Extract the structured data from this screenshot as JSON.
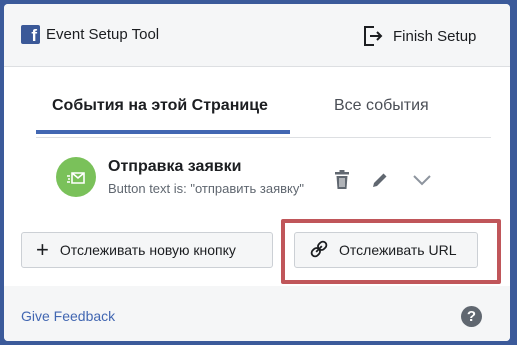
{
  "header": {
    "logo_letter": "f",
    "app_title": "Event Setup Tool",
    "finish_label": "Finish Setup"
  },
  "tabs": [
    {
      "label": "События на этой Странице",
      "active": true
    },
    {
      "label": "Все события",
      "active": false
    }
  ],
  "event": {
    "name": "Отправка заявки",
    "description": "Button text is: \"отправить заявку\"",
    "icon": "envelope-icon",
    "icon_color": "#7ac15a"
  },
  "actions": {
    "track_button_label": "Отслеживать новую кнопку",
    "track_url_label": "Отслеживать URL"
  },
  "footer": {
    "feedback_label": "Give Feedback",
    "help_glyph": "?"
  },
  "colors": {
    "background": "#3b5a9a",
    "accent": "#4267b2",
    "highlight": "#c0565a"
  }
}
